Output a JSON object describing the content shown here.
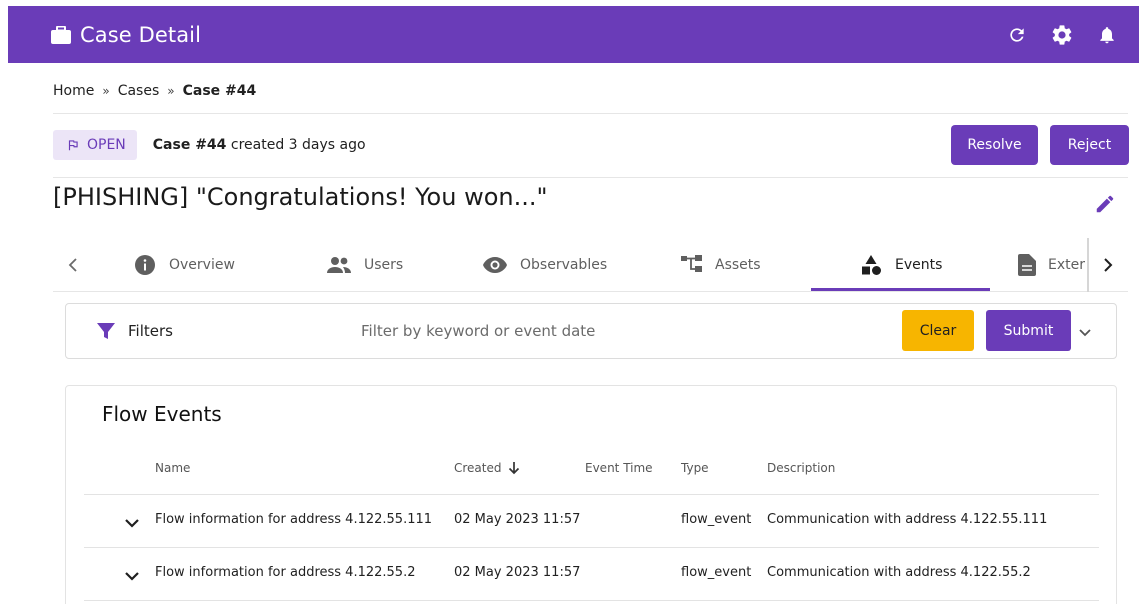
{
  "header": {
    "title": "Case Detail",
    "icons": [
      "briefcase-icon",
      "refresh-icon",
      "gear-icon",
      "bell-icon"
    ]
  },
  "breadcrumb": {
    "items": [
      "Home",
      "Cases",
      "Case #44"
    ],
    "separator": "»"
  },
  "case": {
    "status": "OPEN",
    "number": "Case #44",
    "created_text": "created 3 days ago",
    "title": "[PHISHING] \"Congratulations! You won...\"",
    "resolve_label": "Resolve",
    "reject_label": "Reject"
  },
  "tabs": {
    "items": [
      {
        "label": "Overview",
        "icon": "info-icon"
      },
      {
        "label": "Users",
        "icon": "people-icon"
      },
      {
        "label": "Observables",
        "icon": "eye-icon"
      },
      {
        "label": "Assets",
        "icon": "asset-tree-icon"
      },
      {
        "label": "Events",
        "icon": "shapes-icon",
        "active": true
      },
      {
        "label": "Exter",
        "icon": "document-icon"
      }
    ]
  },
  "filters": {
    "label": "Filters",
    "placeholder": "Filter by keyword or event date",
    "clear_label": "Clear",
    "submit_label": "Submit"
  },
  "events": {
    "title": "Flow Events",
    "columns": [
      "Name",
      "Created",
      "Event Time",
      "Type",
      "Description"
    ],
    "rows": [
      {
        "name": "Flow information for address 4.122.55.111",
        "created": "02 May 2023 11:57",
        "event_time": "",
        "type": "flow_event",
        "description": "Communication with address 4.122.55.111"
      },
      {
        "name": "Flow information for address 4.122.55.2",
        "created": "02 May 2023 11:57",
        "event_time": "",
        "type": "flow_event",
        "description": "Communication with address 4.122.55.2"
      }
    ]
  },
  "colors": {
    "primary": "#6a3cb8",
    "badge_bg": "#ece5f7",
    "clear_button": "#f7b500"
  }
}
